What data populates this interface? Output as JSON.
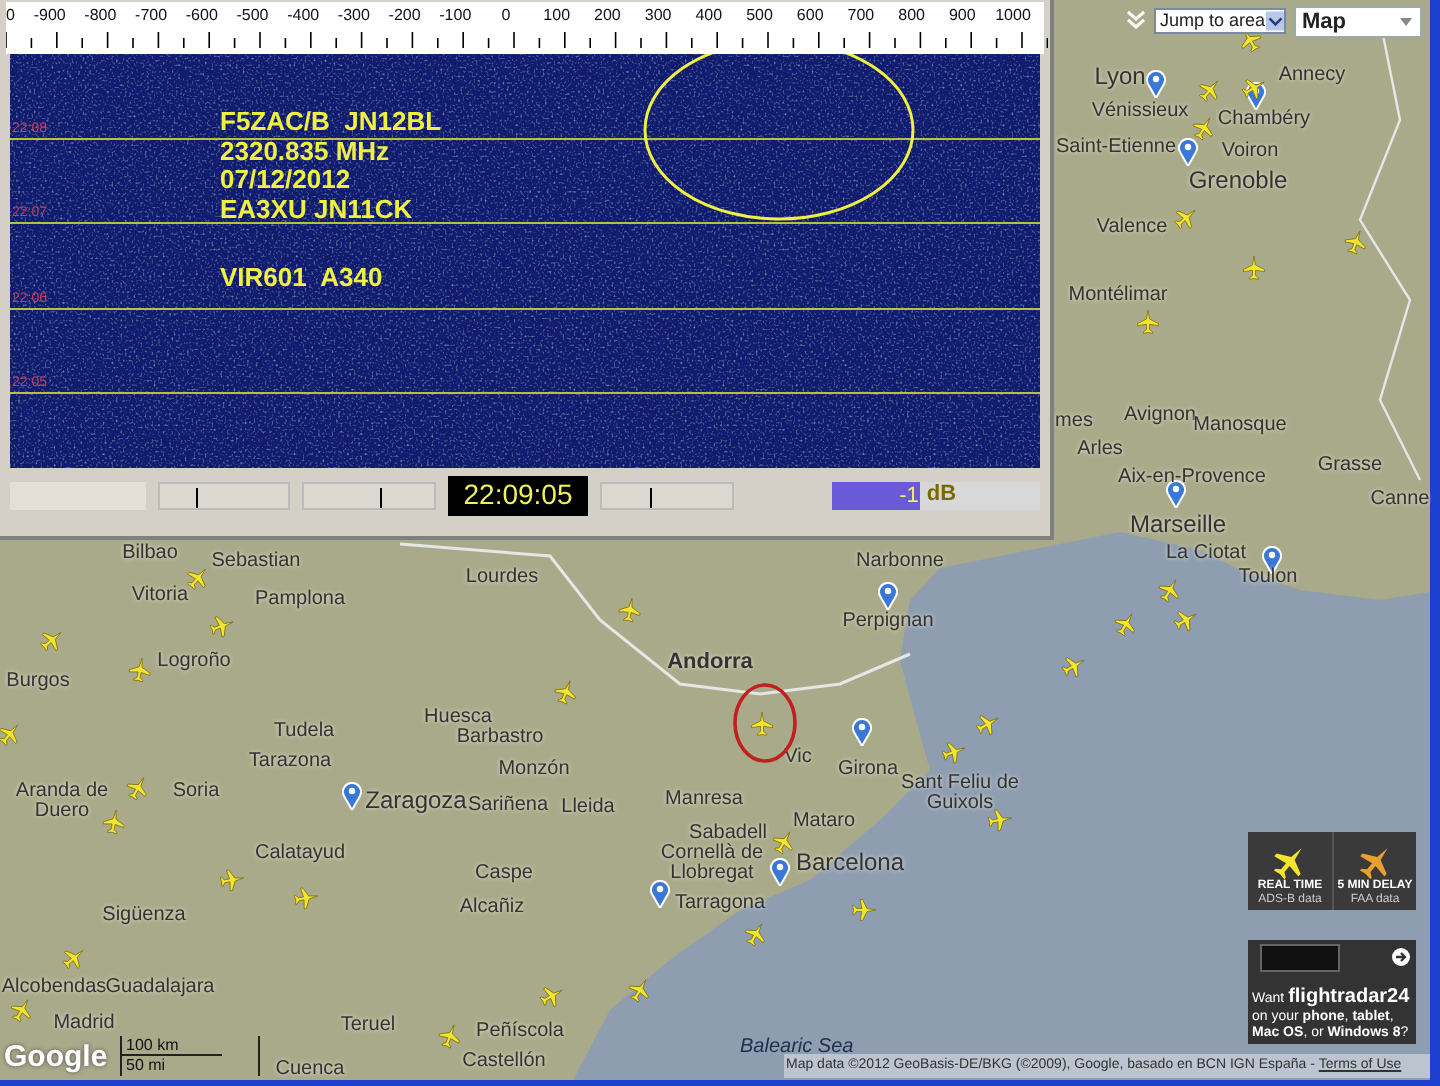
{
  "waterfall": {
    "scale_labels": [
      "0",
      "-900",
      "-800",
      "-700",
      "-600",
      "-500",
      "-400",
      "-300",
      "-200",
      "-100",
      "0",
      "100",
      "200",
      "300",
      "400",
      "500",
      "600",
      "700",
      "800",
      "900",
      "1000"
    ],
    "time_labels": [
      "22:08",
      "22:07",
      "22:06",
      "22:05"
    ],
    "annotation_lines": [
      "F5ZAC/B  JN12BL",
      "2320.835 MHz",
      "07/12/2012",
      "EA3XU JN11CK"
    ],
    "flight_line": "VIR601  A340"
  },
  "controls": {
    "sliders": [
      {
        "level": 0.28
      },
      {
        "level": 0.58
      },
      {
        "level": 0.37
      }
    ],
    "clock": "22:09:05",
    "gain_reading": "-1",
    "gain_unit": "dB"
  },
  "map": {
    "jump_to": "Jump to area",
    "map_type": "Map",
    "places": [
      "Lyon",
      "Annecy",
      "Vénissieux",
      "Chambéry",
      "Saint-Etienne",
      "Voiron",
      "Grenoble",
      "Valence",
      "Montélimar",
      "mes",
      "Avignon",
      "Manosque",
      "Arles",
      "Grasse",
      "Aix-en-Provence",
      "Canne",
      "Marseille",
      "Bilbao",
      "Sebastian",
      "Narbonne",
      "La Ciotat",
      "Lourdes",
      "Toulon",
      "Vitoria",
      "Pamplona",
      "Perpignan",
      "Logroño",
      "Andorra",
      "Burgos",
      "Huesca",
      "Tudela",
      "Barbastro",
      "Tarazona",
      "Monzón",
      "Vic",
      "Girona",
      "Aranda de Duero",
      "Soria",
      "Zaragoza",
      "Sariñena",
      "Lleida",
      "Manresa",
      "Sant Feliu de Guixols",
      "Sabadell",
      "Mataro",
      "Calatayud",
      "Cornellà de Llobregat",
      "Barcelona",
      "Caspe",
      "Sigüenza",
      "Alcañiz",
      "Tarragona",
      "Alcobendas",
      "Guadalajara",
      "Madrid",
      "Teruel",
      "Peñíscola",
      "Cuenca",
      "Castellón"
    ],
    "sea_label": "Balearic Sea",
    "scale_km": "100 km",
    "scale_mi": "50 mi",
    "logo": "Google",
    "attribution": "Map data ©2012 GeoBasis-DE/BKG (©2009), Google, basado en BCN IGN España -",
    "terms_link": "Terms of Use"
  },
  "promo": {
    "tiles": [
      {
        "title": "REAL TIME",
        "subtitle": "ADS-B data"
      },
      {
        "title": "5 MIN DELAY",
        "subtitle": "FAA data"
      }
    ],
    "app_want": "Want",
    "app_brand": "flightradar24",
    "app_text": "on your **phone**, **tablet**, **Mac OS**, or **Windows 8**?"
  }
}
